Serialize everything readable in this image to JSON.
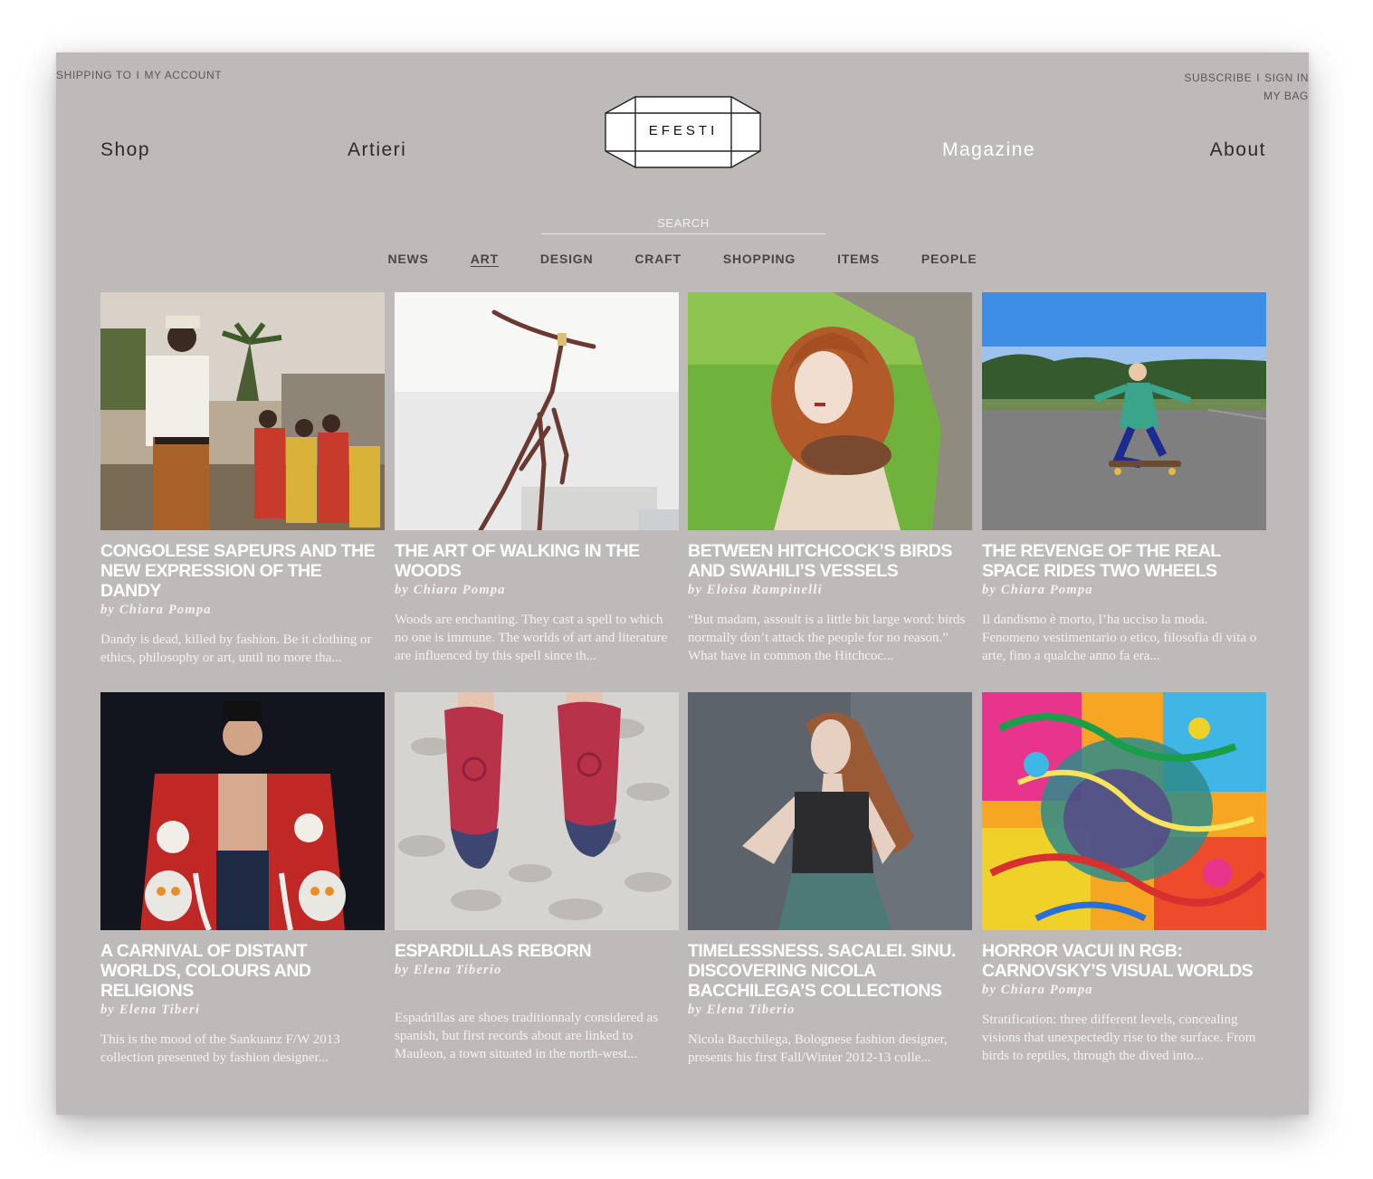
{
  "utility_left": {
    "shipping": "SHIPPING TO",
    "separator": "I",
    "account": "MY ACCOUNT"
  },
  "utility_right": {
    "subscribe": "SUBSCRIBE",
    "separator": "I",
    "signin": "SIGN IN",
    "bag": "MY BAG"
  },
  "nav": {
    "shop": "Shop",
    "artieri": "Artieri",
    "magazine": "Magazine",
    "about": "About"
  },
  "logo": {
    "text": "EFESTI"
  },
  "search": {
    "placeholder": "SEARCH"
  },
  "categories": [
    "NEWS",
    "ART",
    "DESIGN",
    "CRAFT",
    "SHOPPING",
    "ITEMS",
    "PEOPLE"
  ],
  "active_category": "ART",
  "colors": {
    "page_bg": "#bfbaba",
    "text_dark": "#2e2a2a",
    "text_light": "#ffffff"
  },
  "articles": [
    {
      "title": "CONGOLESE SAPEURS AND THE NEW EXPRESSION OF THE DANDY",
      "author": "by Chiara Pompa",
      "excerpt": "Dandy is dead, killed by fashion. Be it clothing or ethics, philosophy or art, until no more tha...",
      "image": "sapeur-photo"
    },
    {
      "title": "THE ART OF WALKING IN THE WOODS",
      "author": "by Chiara Pompa",
      "excerpt": "Woods are enchanting. They cast a spell to which no one is immune. The worlds of art and literature are influenced by this spell since th...",
      "image": "branch-sculpture-photo"
    },
    {
      "title": "BETWEEN HITCHCOCK’S BIRDS AND SWAHILI’S VESSELS",
      "author": "by Eloisa Rampinelli",
      "excerpt": "“But madam, assoult is a little bit large word: birds normally don’t attack the people for no reason.” What have in common the Hitchcoc...",
      "image": "redhead-feather-collar-photo"
    },
    {
      "title": "THE REVENGE OF THE REAL SPACE RIDES TWO WHEELS",
      "author": "by Chiara Pompa",
      "excerpt": "Il dandismo è morto, l’ha ucciso la moda. Fenomeno vestimentario o etico, filosofia di vita o arte, fino a qualche anno fa era...",
      "image": "skateboard-girl-photo"
    },
    {
      "title": "A CARNIVAL OF DISTANT WORLDS, COLOURS AND RELIGIONS",
      "author": "by Elena Tiberi",
      "excerpt": "This is the mood of the Sankuanz F/W 2013 collection presented by fashion designer...",
      "image": "runway-red-coat-photo"
    },
    {
      "title": "ESPARDILLAS REBORN",
      "author": "by Elena Tiberio",
      "excerpt": "Espadrillas are shoes traditionnaly considered as spanish, but first records about are linked to Mauleon, a town situated in the north-west...",
      "image": "espadrilles-photo"
    },
    {
      "title": "TIMELESSNESS. SACALEI. SINU. DISCOVERING NICOLA BACCHILEGA’S COLLECTIONS",
      "author": "by Elena Tiberio",
      "excerpt": "Nicola Bacchilega, Bolognese fashion designer, presents his first Fall/Winter  2012-13 colle...",
      "image": "model-portrait-photo"
    },
    {
      "title": "HORROR VACUI IN RGB: CARNOVSKY’S VISUAL WORLDS",
      "author": "by Chiara Pompa",
      "excerpt": "Stratification: three different levels, concealing visions that unexpectedly rise to the surface. From birds to reptiles, through the dived into...",
      "image": "rgb-artwork-image"
    }
  ]
}
